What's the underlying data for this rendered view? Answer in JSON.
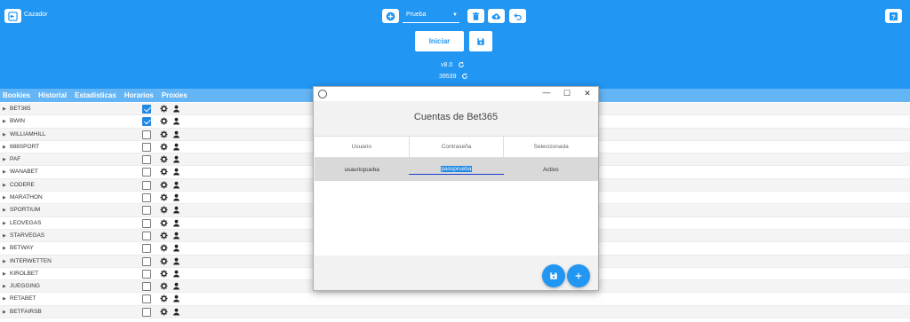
{
  "header": {
    "app_title": "Cazador",
    "profile_select": "Prueba",
    "start_button": "Iniciar",
    "version": "v8.0",
    "count": "39539"
  },
  "tabs": [
    "Bookies",
    "Historial",
    "Estadisticas",
    "Horarios",
    "Proxies"
  ],
  "bookies": [
    {
      "name": "BET365",
      "checked": true
    },
    {
      "name": "BWIN",
      "checked": true
    },
    {
      "name": "WILLIAMHILL",
      "checked": false
    },
    {
      "name": "888SPORT",
      "checked": false
    },
    {
      "name": "PAF",
      "checked": false
    },
    {
      "name": "WANABET",
      "checked": false
    },
    {
      "name": "CODERE",
      "checked": false
    },
    {
      "name": "MARATHON",
      "checked": false
    },
    {
      "name": "SPORTIUM",
      "checked": false
    },
    {
      "name": "LEOVEGAS",
      "checked": false
    },
    {
      "name": "STARVEGAS",
      "checked": false
    },
    {
      "name": "BETWAY",
      "checked": false
    },
    {
      "name": "INTERWETTEN",
      "checked": false
    },
    {
      "name": "KIROLBET",
      "checked": false
    },
    {
      "name": "JUEGGING",
      "checked": false
    },
    {
      "name": "RETABET",
      "checked": false
    },
    {
      "name": "BETFAIRSB",
      "checked": false
    }
  ],
  "dialog": {
    "title": "Cuentas de Bet365",
    "columns": [
      "Usuario",
      "Contraseña",
      "Seleccionada"
    ],
    "rows": [
      {
        "usuario": "usauriopueba",
        "contrasena": "passprueba",
        "seleccionada": "Activo"
      }
    ]
  },
  "colors": {
    "header_bg": "#2196f3",
    "tabs_bg": "#64b5f6",
    "accent": "#1e88e5"
  }
}
